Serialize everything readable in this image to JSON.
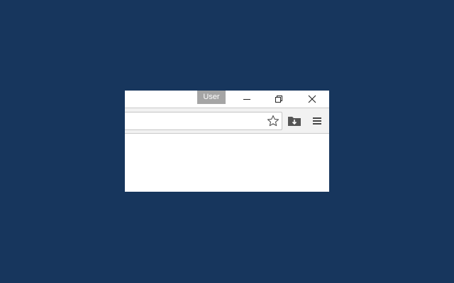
{
  "titlebar": {
    "user_label": "User"
  },
  "window_controls": {
    "minimize_icon": "minimize-icon",
    "restore_icon": "restore-icon",
    "close_icon": "close-icon"
  },
  "toolbar": {
    "address_value": "",
    "bookmark_icon": "star-outline-icon",
    "downloads_icon": "folder-download-icon",
    "menu_icon": "hamburger-menu-icon"
  },
  "colors": {
    "desktop": "#17365d",
    "user_badge": "#a5a5a5",
    "toolbar": "#f2f2f2"
  }
}
